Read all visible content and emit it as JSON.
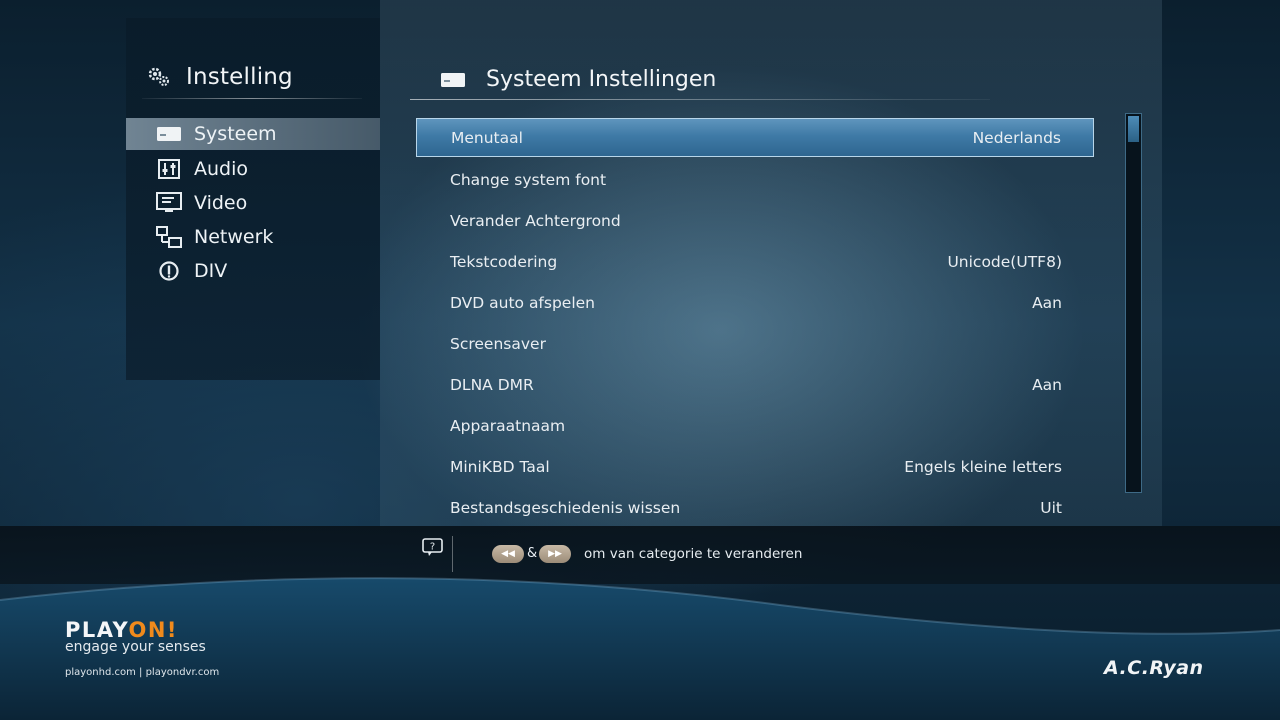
{
  "sidebar": {
    "title": "Instelling",
    "items": [
      {
        "label": "Systeem",
        "icon": "system-icon",
        "active": true
      },
      {
        "label": "Audio",
        "icon": "audio-icon",
        "active": false
      },
      {
        "label": "Video",
        "icon": "video-icon",
        "active": false
      },
      {
        "label": "Netwerk",
        "icon": "network-icon",
        "active": false
      },
      {
        "label": "DIV",
        "icon": "info-icon",
        "active": false
      }
    ]
  },
  "main": {
    "title": "Systeem Instellingen",
    "rows": [
      {
        "label": "Menutaal",
        "value": "Nederlands"
      },
      {
        "label": "Change system font",
        "value": ""
      },
      {
        "label": "Verander Achtergrond",
        "value": ""
      },
      {
        "label": "Tekstcodering",
        "value": "Unicode(UTF8)"
      },
      {
        "label": "DVD auto afspelen",
        "value": "Aan"
      },
      {
        "label": "Screensaver",
        "value": ""
      },
      {
        "label": "DLNA DMR",
        "value": "Aan"
      },
      {
        "label": "Apparaatnaam",
        "value": ""
      },
      {
        "label": "MiniKBD Taal",
        "value": "Engels kleine letters"
      },
      {
        "label": "Bestandsgeschiedenis wissen",
        "value": "Uit"
      }
    ]
  },
  "help": {
    "amp": "&",
    "text": "om van categorie te veranderen"
  },
  "branding": {
    "logo_left": "PLAY",
    "logo_accent": "ON!",
    "tagline": "engage your senses",
    "urls": "playonhd.com  |  playondvr.com",
    "maker": "A.C.Ryan"
  },
  "colors": {
    "selection": "#3f7aa6",
    "accent": "#f08a1c"
  }
}
